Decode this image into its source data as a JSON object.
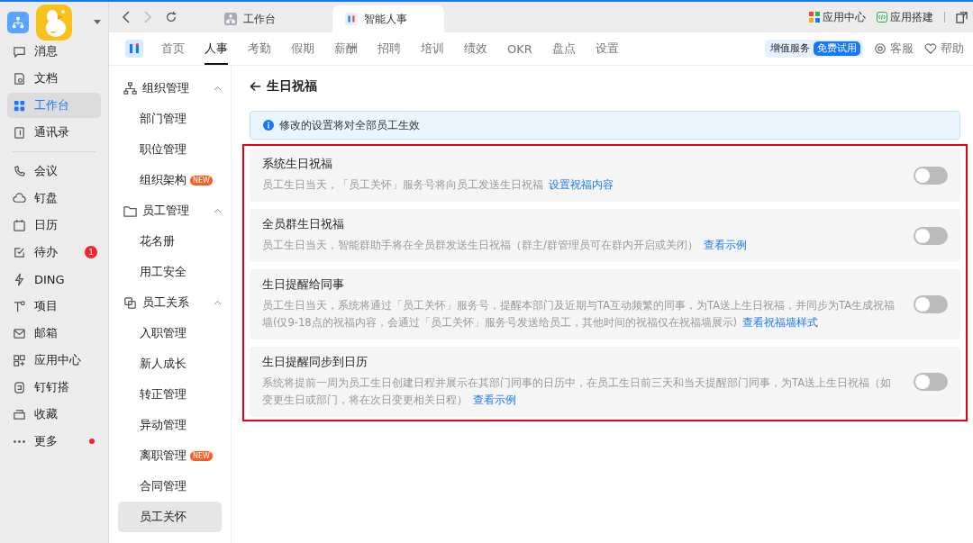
{
  "browser_tabs": [
    {
      "label": "工作台",
      "selected": false
    },
    {
      "label": "智能人事",
      "selected": true
    }
  ],
  "top_links": [
    "应用中心",
    "应用搭建"
  ],
  "rail": {
    "groups": [
      [
        {
          "label": "消息",
          "selected": false
        },
        {
          "label": "文档",
          "selected": false
        },
        {
          "label": "工作台",
          "selected": true
        },
        {
          "label": "通讯录",
          "selected": false
        }
      ],
      [
        {
          "label": "会议",
          "selected": false
        },
        {
          "label": "钉盘",
          "selected": false
        },
        {
          "label": "日历",
          "selected": false
        },
        {
          "label": "待办",
          "selected": false,
          "badge": "1"
        },
        {
          "label": "DING",
          "selected": false
        },
        {
          "label": "项目",
          "selected": false
        },
        {
          "label": "邮箱",
          "selected": false
        },
        {
          "label": "应用中心",
          "selected": false
        },
        {
          "label": "钉钉搭",
          "selected": false
        },
        {
          "label": "收藏",
          "selected": false
        },
        {
          "label": "更多",
          "selected": false,
          "dot": true
        }
      ]
    ]
  },
  "nav": {
    "tabs": [
      {
        "label": "首页",
        "selected": false
      },
      {
        "label": "人事",
        "selected": true
      },
      {
        "label": "考勤",
        "selected": false
      },
      {
        "label": "假期",
        "selected": false
      },
      {
        "label": "薪酬",
        "selected": false
      },
      {
        "label": "招聘",
        "selected": false
      },
      {
        "label": "培训",
        "selected": false
      },
      {
        "label": "绩效",
        "selected": false
      },
      {
        "label": "OKR",
        "selected": false
      },
      {
        "label": "盘点",
        "selected": false
      },
      {
        "label": "设置",
        "selected": false
      }
    ],
    "service": "增值服务",
    "trial": "免费试用",
    "support": "客服",
    "help": "帮助"
  },
  "menu": [
    {
      "label": "组织管理",
      "expanded": true,
      "children": [
        {
          "label": "部门管理",
          "selected": false
        },
        {
          "label": "职位管理",
          "selected": false
        },
        {
          "label": "组织架构",
          "selected": false,
          "tag": "NEW"
        }
      ]
    },
    {
      "label": "员工管理",
      "expanded": true,
      "children": [
        {
          "label": "花名册",
          "selected": false
        },
        {
          "label": "用工安全",
          "selected": false
        }
      ]
    },
    {
      "label": "员工关系",
      "expanded": true,
      "children": [
        {
          "label": "入职管理",
          "selected": false
        },
        {
          "label": "新人成长",
          "selected": false
        },
        {
          "label": "转正管理",
          "selected": false
        },
        {
          "label": "异动管理",
          "selected": false
        },
        {
          "label": "离职管理",
          "selected": false,
          "tag": "NEW"
        },
        {
          "label": "合同管理",
          "selected": false
        },
        {
          "label": "员工关怀",
          "selected": true
        }
      ]
    }
  ],
  "page": {
    "title": "生日祝福",
    "notice": "修改的设置将对全部员工生效",
    "settings": [
      {
        "title": "系统生日祝福",
        "description": "员工生日当天，「员工关怀」服务号将向员工发送生日祝福",
        "link": "设置祝福内容",
        "on": false
      },
      {
        "title": "全员群生日祝福",
        "description": "员工生日当天，智能群助手将在全员群发送生日祝福（群主/群管理员可在群内开启或关闭）",
        "link": "查看示例",
        "on": false
      },
      {
        "title": "生日提醒给同事",
        "description": "员工生日当天，系统将通过「员工关怀」服务号，提醒本部门及近期与TA互动频繁的同事，为TA送上生日祝福，并同步为TA生成祝福墙(仅9-18点的祝福内容，会通过「员工关怀」服务号发送给员工，其他时间的祝福仅在祝福墙展示)",
        "link": "查看祝福墙样式",
        "on": false
      },
      {
        "title": "生日提醒同步到日历",
        "description": "系统将提前一周为员工生日创建日程并展示在其部门同事的日历中，在员工生日前三天和当天提醒部门同事，为TA送上生日祝福（如变更生日或部门，将在次日变更相关日程）",
        "link": "查看示例",
        "on": false
      }
    ]
  }
}
